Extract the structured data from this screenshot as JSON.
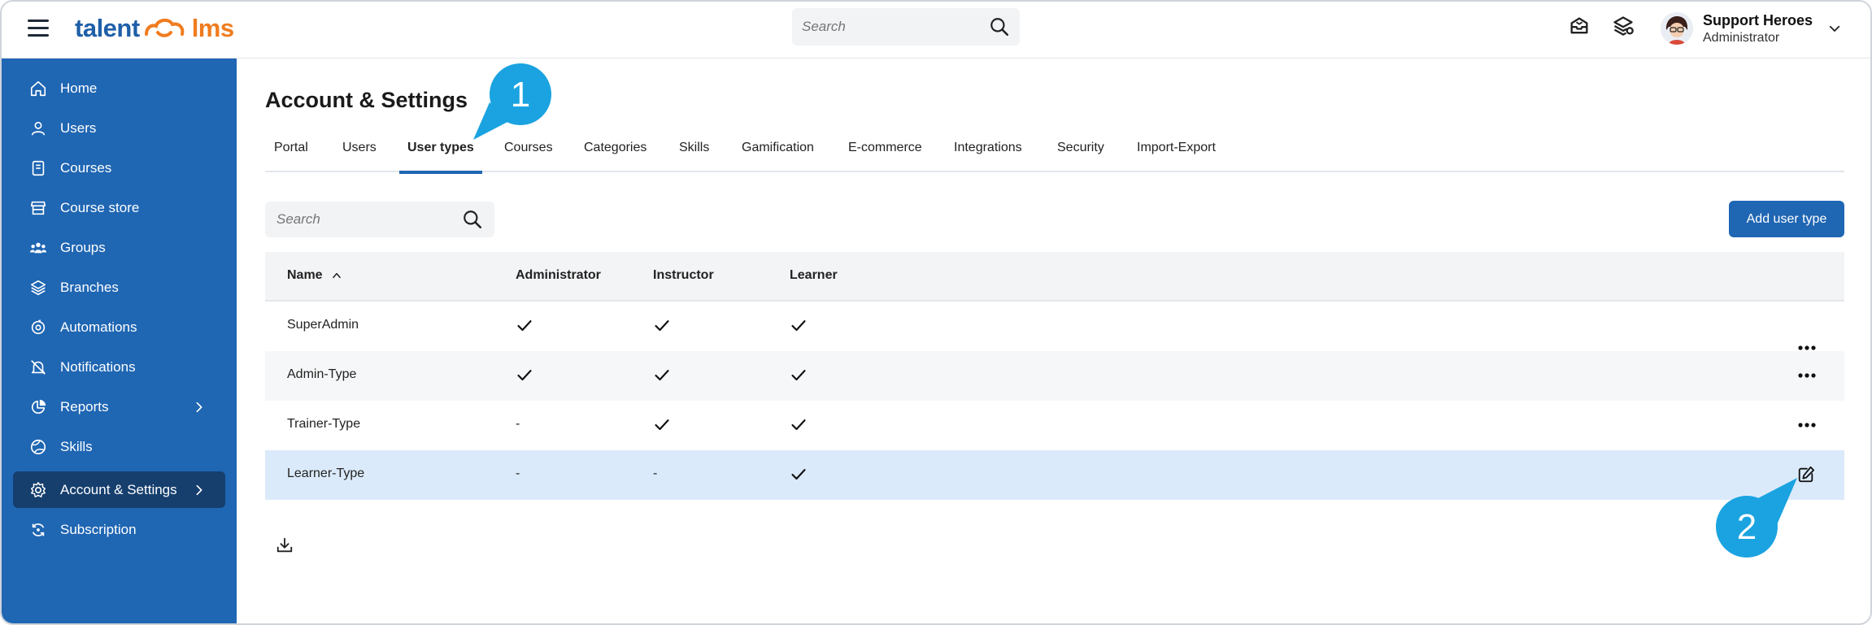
{
  "header": {
    "logo_left": "talent",
    "logo_right": "lms",
    "search_placeholder": "Search",
    "user_name": "Support Heroes",
    "user_role": "Administrator"
  },
  "sidebar": {
    "items": [
      {
        "label": "Home",
        "icon": "home-icon"
      },
      {
        "label": "Users",
        "icon": "user-icon"
      },
      {
        "label": "Courses",
        "icon": "book-icon"
      },
      {
        "label": "Course store",
        "icon": "store-icon"
      },
      {
        "label": "Groups",
        "icon": "group-icon"
      },
      {
        "label": "Branches",
        "icon": "layers-icon"
      },
      {
        "label": "Automations",
        "icon": "automation-icon"
      },
      {
        "label": "Notifications",
        "icon": "bell-icon"
      },
      {
        "label": "Reports",
        "icon": "pie-chart-icon"
      },
      {
        "label": "Skills",
        "icon": "globe-icon"
      },
      {
        "label": "Account & Settings",
        "icon": "gear-icon"
      },
      {
        "label": "Subscription",
        "icon": "refresh-icon"
      }
    ]
  },
  "page": {
    "title": "Account & Settings",
    "tabs": [
      "Portal",
      "Users",
      "User types",
      "Courses",
      "Categories",
      "Skills",
      "Gamification",
      "E-commerce",
      "Integrations",
      "Security",
      "Import-Export"
    ],
    "active_tab": "User types",
    "search_placeholder": "Search",
    "add_button": "Add user type"
  },
  "table": {
    "columns": [
      "Name",
      "Administrator",
      "Instructor",
      "Learner"
    ],
    "rows": [
      {
        "name": "SuperAdmin",
        "administrator": "check",
        "instructor": "check",
        "learner": "check"
      },
      {
        "name": "Admin-Type",
        "administrator": "check",
        "instructor": "check",
        "learner": "check"
      },
      {
        "name": "Trainer-Type",
        "administrator": "-",
        "instructor": "check",
        "learner": "check"
      },
      {
        "name": "Learner-Type",
        "administrator": "-",
        "instructor": "-",
        "learner": "check"
      }
    ]
  },
  "callouts": {
    "first": "1",
    "second": "2"
  },
  "colors": {
    "sidebar": "#1f66b3",
    "sidebar_active": "#163f6e",
    "accent": "#1f66b3",
    "callout": "#1aa3e0",
    "logo_orange": "#f07c1f"
  }
}
